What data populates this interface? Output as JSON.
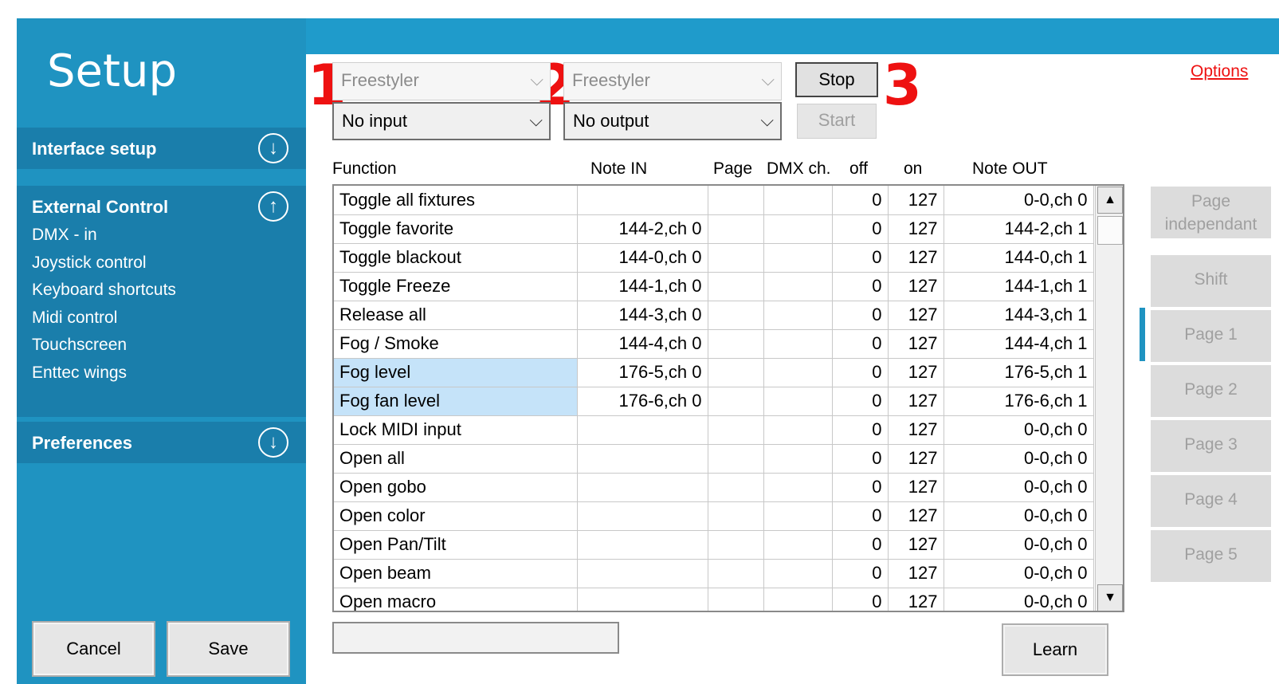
{
  "sidebar": {
    "title": "Setup",
    "sections": {
      "interface_setup": "Interface setup",
      "external_control": "External Control",
      "preferences": "Preferences"
    },
    "external_items": [
      "DMX - in",
      "Joystick control",
      "Keyboard shortcuts",
      "Midi control",
      "Touchscreen",
      "Enttec wings"
    ],
    "cancel_label": "Cancel",
    "save_label": "Save"
  },
  "annotations": {
    "n1": "1",
    "n2": "2",
    "n3": "3"
  },
  "input": {
    "device": "Freestyler",
    "port": "No input"
  },
  "output": {
    "device": "Freestyler",
    "port": "No output"
  },
  "buttons": {
    "stop": "Stop",
    "start": "Start",
    "learn": "Learn"
  },
  "options_link": "Options",
  "table": {
    "headers": {
      "function": "Function",
      "note_in": "Note IN",
      "page": "Page",
      "dmx": "DMX ch.",
      "off": "off",
      "on": "on",
      "note_out": "Note OUT"
    },
    "rows": [
      {
        "function": "Toggle all fixtures",
        "note_in": "",
        "page": "",
        "dmx": "",
        "off": "0",
        "on": "127",
        "note_out": "0-0,ch 0"
      },
      {
        "function": "Toggle favorite",
        "note_in": "144-2,ch 0",
        "page": "",
        "dmx": "",
        "off": "0",
        "on": "127",
        "note_out": "144-2,ch 1"
      },
      {
        "function": "Toggle blackout",
        "note_in": "144-0,ch 0",
        "page": "",
        "dmx": "",
        "off": "0",
        "on": "127",
        "note_out": "144-0,ch 1"
      },
      {
        "function": "Toggle Freeze",
        "note_in": "144-1,ch 0",
        "page": "",
        "dmx": "",
        "off": "0",
        "on": "127",
        "note_out": "144-1,ch 1"
      },
      {
        "function": "Release all",
        "note_in": "144-3,ch 0",
        "page": "",
        "dmx": "",
        "off": "0",
        "on": "127",
        "note_out": "144-3,ch 1"
      },
      {
        "function": "Fog / Smoke",
        "note_in": "144-4,ch 0",
        "page": "",
        "dmx": "",
        "off": "0",
        "on": "127",
        "note_out": "144-4,ch 1"
      },
      {
        "function": "Fog level",
        "note_in": "176-5,ch 0",
        "page": "",
        "dmx": "",
        "off": "0",
        "on": "127",
        "note_out": "176-5,ch 1"
      },
      {
        "function": "Fog fan level",
        "note_in": "176-6,ch 0",
        "page": "",
        "dmx": "",
        "off": "0",
        "on": "127",
        "note_out": "176-6,ch 1"
      },
      {
        "function": "Lock MIDI input",
        "note_in": "",
        "page": "",
        "dmx": "",
        "off": "0",
        "on": "127",
        "note_out": "0-0,ch 0"
      },
      {
        "function": "Open all",
        "note_in": "",
        "page": "",
        "dmx": "",
        "off": "0",
        "on": "127",
        "note_out": "0-0,ch 0"
      },
      {
        "function": "Open gobo",
        "note_in": "",
        "page": "",
        "dmx": "",
        "off": "0",
        "on": "127",
        "note_out": "0-0,ch 0"
      },
      {
        "function": "Open color",
        "note_in": "",
        "page": "",
        "dmx": "",
        "off": "0",
        "on": "127",
        "note_out": "0-0,ch 0"
      },
      {
        "function": "Open Pan/Tilt",
        "note_in": "",
        "page": "",
        "dmx": "",
        "off": "0",
        "on": "127",
        "note_out": "0-0,ch 0"
      },
      {
        "function": "Open beam",
        "note_in": "",
        "page": "",
        "dmx": "",
        "off": "0",
        "on": "127",
        "note_out": "0-0,ch 0"
      },
      {
        "function": "Open macro",
        "note_in": "",
        "page": "",
        "dmx": "",
        "off": "0",
        "on": "127",
        "note_out": "0-0,ch 0"
      }
    ]
  },
  "pages": {
    "independant_1": "Page",
    "independant_2": "independant",
    "shift": "Shift",
    "p1": "Page 1",
    "p2": "Page 2",
    "p3": "Page 3",
    "p4": "Page 4",
    "p5": "Page 5"
  },
  "colors": {
    "sidebar": "#1f93c1",
    "sidebar_dark": "#1a7eab",
    "annotation": "#ee1111",
    "selection": "#c5e3f9"
  }
}
